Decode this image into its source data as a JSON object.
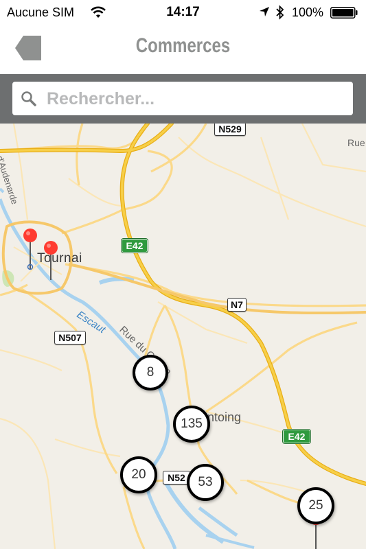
{
  "status_bar": {
    "carrier": "Aucune SIM",
    "time": "14:17",
    "battery_percent": "100%",
    "icons": [
      "wifi-icon",
      "location-arrow-icon",
      "bluetooth-icon",
      "battery-icon"
    ]
  },
  "nav": {
    "title": "Commerces",
    "back_icon": "back-arrow-icon"
  },
  "search": {
    "placeholder": "Rechercher...",
    "value": ""
  },
  "map": {
    "place_labels": {
      "tournai": "Tournai",
      "antoing": "ntoing",
      "escaut": "Escaut",
      "rue_du_canon": "Rue du Canon",
      "av_audenarde": "Av. d'Audenarde",
      "rue_right": "Rue"
    },
    "road_shields": {
      "n529": "N529",
      "e42_top": "E42",
      "n7": "N7",
      "n507": "N507",
      "e42_bottom": "E42",
      "n52": "N52"
    },
    "clusters": [
      "8",
      "135",
      "20",
      "53",
      "25"
    ],
    "pins": [
      "pin-tournai-1",
      "pin-tournai-2",
      "pin-southeast"
    ],
    "colors": {
      "land": "#f2efe8",
      "highway": "#f5c324",
      "road": "#fbd98a",
      "water": "#a8d2ef",
      "park": "#cde6b5",
      "pin": "#ff3b30"
    }
  }
}
